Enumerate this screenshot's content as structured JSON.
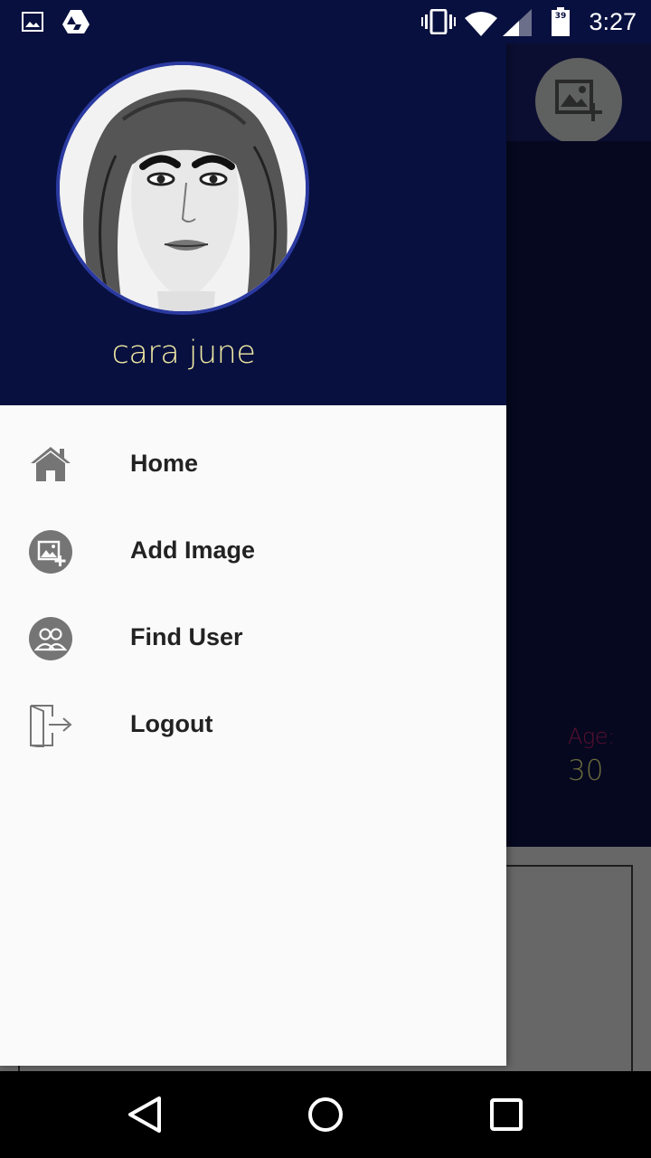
{
  "status_bar": {
    "time": "3:27",
    "battery_level": "39",
    "icons": [
      "image-icon",
      "drive-icon",
      "vibrate-icon",
      "wifi-icon",
      "signal-icon",
      "battery-icon"
    ]
  },
  "drawer": {
    "user_name": "cara june",
    "menu": [
      {
        "label": "Home",
        "icon": "home-icon"
      },
      {
        "label": "Add Image",
        "icon": "add-image-icon"
      },
      {
        "label": "Find User",
        "icon": "find-user-icon"
      },
      {
        "label": "Logout",
        "icon": "logout-icon"
      }
    ]
  },
  "background": {
    "age_label": "Age:",
    "age_value": "30"
  },
  "colors": {
    "header_bg": "#08103f",
    "name_color": "#f0eaa4",
    "drawer_bg": "#fafafa",
    "icon_gray": "#757575",
    "avatar_border": "#2b3aa0"
  }
}
